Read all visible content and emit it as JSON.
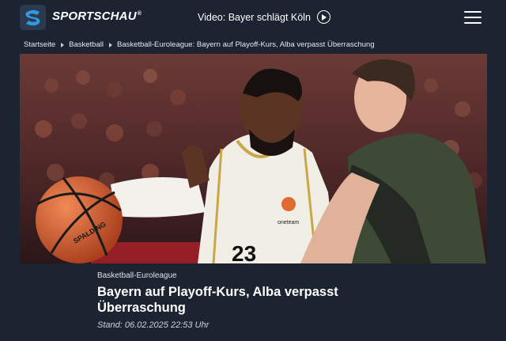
{
  "header": {
    "brand": "SPORTSCHAU",
    "brand_mark": "®",
    "video_label": "Video: Bayer schlägt Köln",
    "icons": {
      "logo": "sportschau-s-logo-icon",
      "play": "play-circle-icon",
      "menu": "hamburger-menu-icon"
    }
  },
  "breadcrumb": {
    "items": [
      "Startseite",
      "Basketball",
      "Basketball-Euroleague: Bayern auf Playoff-Kurs, Alba verpasst Überraschung"
    ]
  },
  "hero": {
    "jersey_number": "23",
    "ball_text": "SPALDING",
    "jersey_badge": "oneteam",
    "colors": {
      "crowd": "#5a2a2a",
      "white_jersey": "#f1eee6",
      "green_jersey": "#3d4a35",
      "ball": "#d2572e"
    }
  },
  "article": {
    "kicker": "Basketball-Euroleague",
    "headline": "Bayern auf Playoff-Kurs, Alba verpasst Überraschung",
    "dateline": "Stand: 06.02.2025 22:53 Uhr"
  },
  "colors": {
    "background": "#1c2431",
    "text": "#ffffff"
  }
}
